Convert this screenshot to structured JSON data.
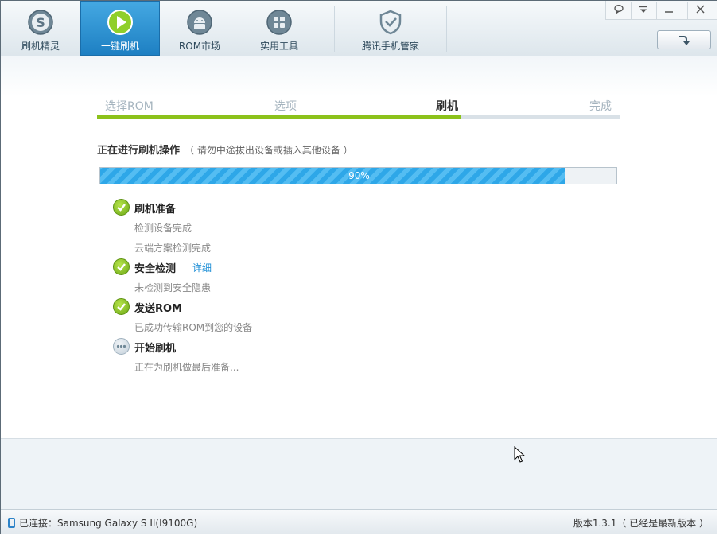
{
  "nav": {
    "tabs": [
      {
        "label": "刷机精灵",
        "icon": "s-logo-icon",
        "active": false
      },
      {
        "label": "一键刷机",
        "icon": "play-icon",
        "active": true
      },
      {
        "label": "ROM市场",
        "icon": "android-icon",
        "active": false
      },
      {
        "label": "实用工具",
        "icon": "grid-icon",
        "active": false
      },
      {
        "label": "腾讯手机管家",
        "icon": "shield-check-icon",
        "active": false
      }
    ]
  },
  "window_controls": {
    "feedback": "speech-bubble-icon",
    "menu": "menu-down-icon",
    "minimize": "minimize-icon",
    "close": "close-icon"
  },
  "steps": {
    "items": [
      "选择ROM",
      "选项",
      "刷机",
      "完成"
    ],
    "current_index": 2,
    "progress_fraction": 0.695
  },
  "operation": {
    "title": "正在进行刷机操作",
    "hint": "（ 请勿中途拔出设备或插入其他设备 ）"
  },
  "progress": {
    "value": 90,
    "label": "90%"
  },
  "tasks": [
    {
      "name": "刷机准备",
      "status": "done",
      "details": [
        "检测设备完成",
        "云端方案检测完成"
      ]
    },
    {
      "name": "安全检测",
      "status": "done",
      "link": "详细",
      "details": [
        "未检测到安全隐患"
      ]
    },
    {
      "name": "发送ROM",
      "status": "done",
      "details": [
        "已成功传输ROM到您的设备"
      ]
    },
    {
      "name": "开始刷机",
      "status": "pending",
      "details": [
        "正在为刷机做最后准备..."
      ]
    }
  ],
  "status": {
    "connection": "已连接：Samsung Galaxy S II(I9100G)",
    "version": "版本1.3.1（ 已经是最新版本 ）"
  },
  "colors": {
    "accent": "#1d7fc2",
    "progress": "#2ea7e8",
    "step_done": "#8cc21b",
    "link": "#1f8fd6"
  }
}
